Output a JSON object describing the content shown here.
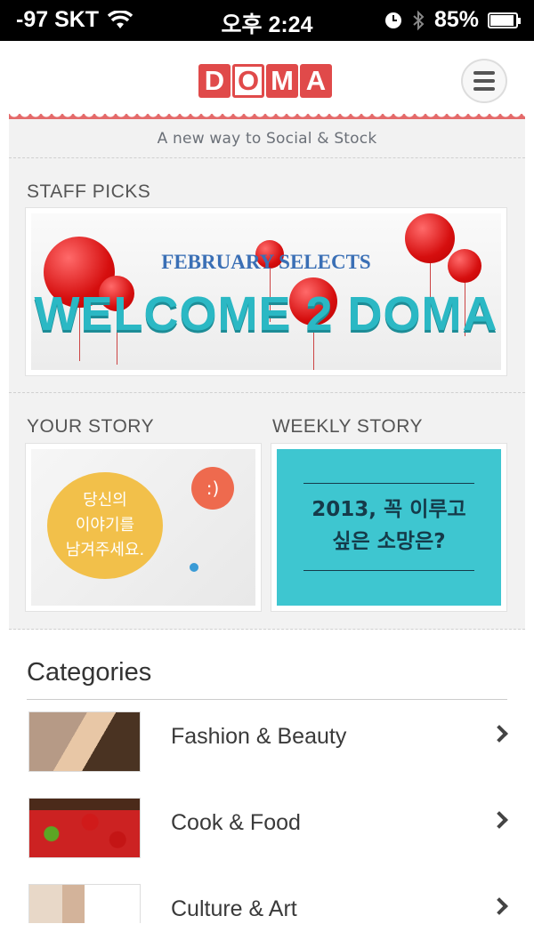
{
  "status_bar": {
    "carrier": "-97 SKT",
    "time": "오후 2:24",
    "battery": "85%",
    "battery_level": 0.85,
    "icons": [
      "wifi-icon",
      "alarm-icon",
      "bluetooth-icon",
      "battery-icon"
    ]
  },
  "header": {
    "logo_letters": [
      "D",
      "O",
      "M",
      "A"
    ],
    "menu_icon": "hamburger-menu-icon"
  },
  "tagline": "A new way to Social & Stock",
  "staff_picks": {
    "title": "STAFF PICKS",
    "banner_subtitle": "FEBRUARY SELECTS",
    "banner_title": "WELCOME 2 DOMA"
  },
  "your_story": {
    "title": "YOUR STORY",
    "bubble_text": "당신의\n이야기를\n남겨주세요.",
    "emoticon": ":)"
  },
  "weekly_story": {
    "title": "WEEKLY STORY",
    "text_line1": "2013, 꼭 이루고",
    "text_line2": "싶은 소망은?"
  },
  "categories": {
    "title": "Categories",
    "items": [
      {
        "label": "Fashion & Beauty"
      },
      {
        "label": "Cook & Food"
      },
      {
        "label": "Culture & Art"
      }
    ]
  },
  "colors": {
    "brand_red": "#e04a4a",
    "accent_teal": "#2bb8c4",
    "text_gray": "#555555"
  }
}
